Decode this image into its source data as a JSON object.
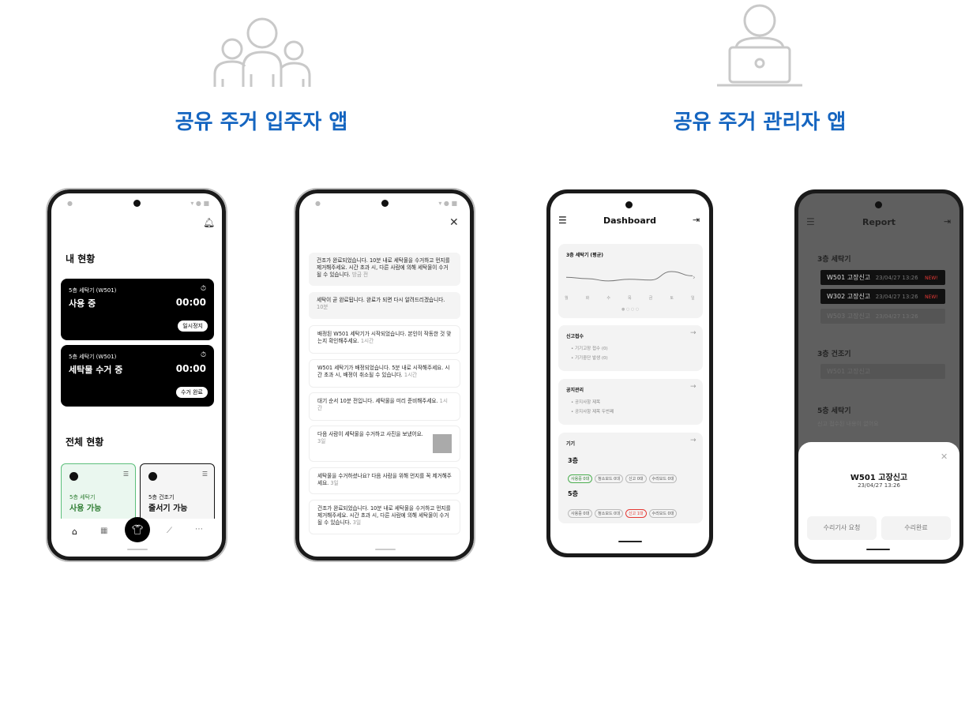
{
  "sections": {
    "resident_title": "공유 주거 입주자 앱",
    "manager_title": "공유 주거 관리자 앱"
  },
  "icons": {
    "resident_people": "people-group-icon",
    "manager_person": "person-laptop-icon"
  },
  "phone1": {
    "my_status_title": "내 현황",
    "card1": {
      "subtitle": "5층 세탁기 (W501)",
      "status": "사용 중",
      "time": "00:00",
      "button": "일시정지"
    },
    "card2": {
      "subtitle": "5층 세탁기 (W501)",
      "status": "세탁물 수거 중",
      "time": "00:00",
      "button": "수거 완료"
    },
    "overall_title": "전체 현황",
    "tile1": {
      "subtitle": "5층 세탁기",
      "status": "사용 가능"
    },
    "tile2": {
      "subtitle": "5층 건조기",
      "status": "줄서기 가능"
    }
  },
  "phone2": {
    "notifications": [
      {
        "text": "건조가 완료되었습니다. 10분 내로 세탁물을 수거하고 먼지를 제거해주세요. 시간 초과 시, 다른 사람에 의해 세탁물이 수거될 수 있습니다.",
        "time": "방금 전"
      },
      {
        "text": "세탁이 곧 완료됩니다. 완료가 되면 다시 알려드리겠습니다.",
        "time": "10분"
      },
      {
        "text": "배정된 W501 세탁기가 시작되었습니다. 본인이 작동한 것 맞는지 확인해주세요.",
        "time": "1시간"
      },
      {
        "text": "W501 세탁기가 배정되었습니다. 5분 내로 시작해주세요. 시간 초과 시, 배정이 취소될 수 있습니다.",
        "time": "1시간"
      },
      {
        "text": "대기 순서 10분 전입니다. 세탁물을 미리 준비해주세요.",
        "time": "1시간"
      },
      {
        "text": "다음 사람이 세탁물을 수거하고 사진을 보냈어요.",
        "time": "3일"
      },
      {
        "text": "세탁물을 수거하셨나요? 다음 사람을 위해 먼지를 꼭 제거해주세요.",
        "time": "3일"
      },
      {
        "text": "건조가 완료되었습니다. 10분 내로 세탁물을 수거하고 먼지를 제거해주세요. 시간 초과 시, 다른 사람에 의해 세탁물이 수거될 수 있습니다.",
        "time": "3일"
      }
    ]
  },
  "phone3": {
    "title": "Dashboard",
    "chart_title": "3층 세탁기 (평균)",
    "chart_days": [
      "월",
      "화",
      "수",
      "목",
      "금",
      "토",
      "일"
    ],
    "chart_levels": [
      0.55,
      0.5,
      0.42,
      0.48,
      0.45,
      0.75,
      0.6
    ],
    "report_title": "신고접수",
    "report_items": [
      "기기고장 접수 (0)",
      "기기중단 발생 (0)"
    ],
    "notice_title": "공지관리",
    "notice_items": [
      "공지사항 제목",
      "공지사항 제목 두번째"
    ],
    "devices_title": "기기",
    "floor3": "3층",
    "floor3_tags": [
      "사용중 0대",
      "청소모드 0대",
      "신고 0대",
      "수리모드 0대"
    ],
    "floor5": "5층",
    "floor5_tags": [
      "사용중 0대",
      "청소모드 0대",
      "신고 1대",
      "수리모드 0대"
    ]
  },
  "phone4": {
    "title": "Report",
    "section1": "3층 세탁기",
    "rows": [
      {
        "label": "W501 고장신고",
        "date": "23/04/27 13:26",
        "badge": "NEW!"
      },
      {
        "label": "W302 고장신고",
        "date": "23/04/27 13:26",
        "badge": "NEW!"
      },
      {
        "label": "W503 고장신고",
        "date": "23/04/27 13:26",
        "badge": ""
      }
    ],
    "section2": "3층 건조기",
    "dryer_row": "W501 고장신고",
    "section3": "5층 세탁기",
    "empty_text": "신고 접수된 내용이 없어요",
    "sheet": {
      "title": "W501 고장신고",
      "date": "23/04/27 13:26",
      "button_left": "수리기사 요청",
      "button_right": "수리완료"
    }
  }
}
